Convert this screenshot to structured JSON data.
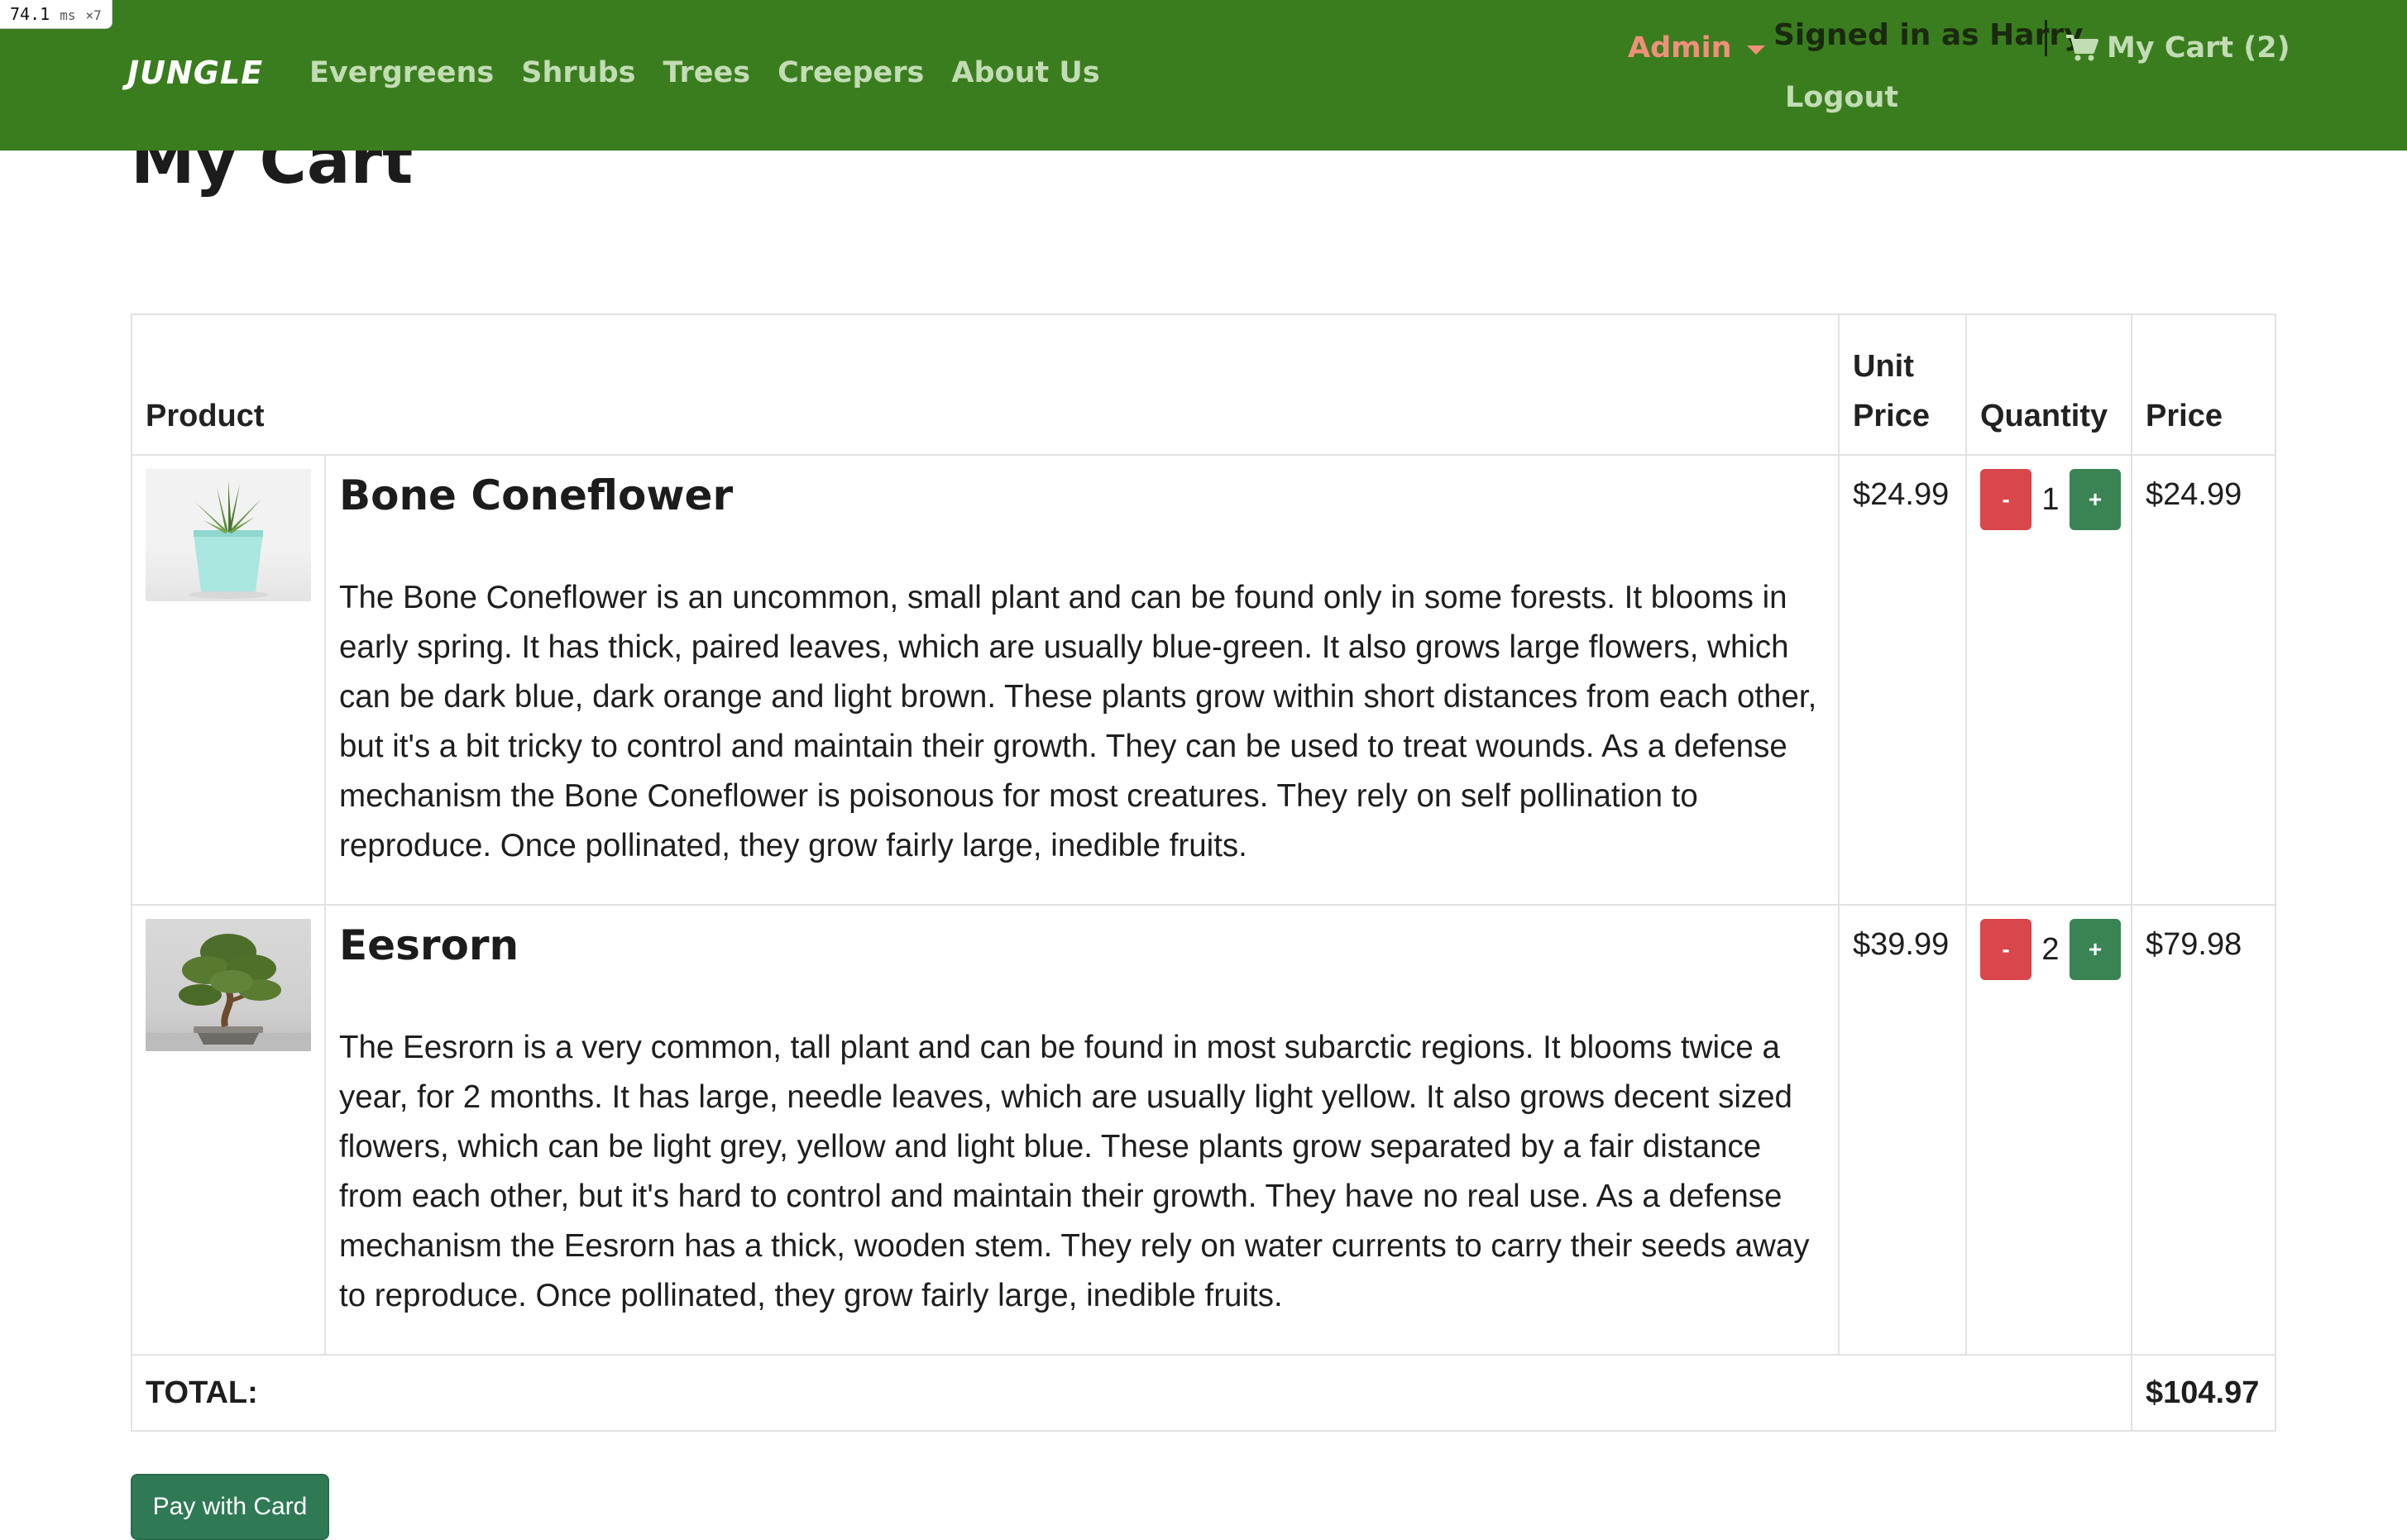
{
  "perf": {
    "value": "74.1",
    "unit": "ms",
    "mult": "×7"
  },
  "nav": {
    "brand": "JUNGLE",
    "links": [
      "Evergreens",
      "Shrubs",
      "Trees",
      "Creepers",
      "About Us"
    ],
    "admin_label": "Admin",
    "signed_in": "Signed in as Harry",
    "cart_label": "My Cart (2)",
    "logout_label": "Logout"
  },
  "page": {
    "title": "My Cart"
  },
  "table": {
    "headers": {
      "product": "Product",
      "unit_price_line1": "Unit",
      "unit_price_line2": "Price",
      "quantity": "Quantity",
      "price": "Price"
    },
    "rows": [
      {
        "name": "Bone Coneflower",
        "description": "The Bone Coneflower is an uncommon, small plant and can be found only in some forests. It blooms in early spring. It has thick, paired leaves, which are usually blue-green. It also grows large flowers, which can be dark blue, dark orange and light brown. These plants grow within short distances from each other, but it's a bit tricky to control and maintain their growth. They can be used to treat wounds. As a defense mechanism the Bone Coneflower is poisonous for most creatures. They rely on self pollination to reproduce. Once pollinated, they grow fairly large, inedible fruits.",
        "unit_price": "$24.99",
        "quantity": "1",
        "price": "$24.99",
        "minus_label": "-",
        "plus_label": "+"
      },
      {
        "name": "Eesrorn",
        "description": "The Eesrorn is a very common, tall plant and can be found in most subarctic regions. It blooms twice a year, for 2 months. It has large, needle leaves, which are usually light yellow. It also grows decent sized flowers, which can be light grey, yellow and light blue. These plants grow separated by a fair distance from each other, but it's hard to control and maintain their growth. They have no real use. As a defense mechanism the Eesrorn has a thick, wooden stem. They rely on water currents to carry their seeds away to reproduce. Once pollinated, they grow fairly large, inedible fruits.",
        "unit_price": "$39.99",
        "quantity": "2",
        "price": "$79.98",
        "minus_label": "-",
        "plus_label": "+"
      }
    ],
    "total_label": "TOTAL:",
    "total_value": "$104.97"
  },
  "pay_button": "Pay with Card",
  "colors": {
    "navbar": "#3a7d1e",
    "nav_link": "#c2dcb4",
    "admin": "#f0907a",
    "minus_button": "#d9464c",
    "plus_button": "#3a8454",
    "pay_button": "#2f7a55"
  },
  "icons": {
    "admin_caret": "caret-down-icon",
    "cart": "shopping-cart-icon"
  }
}
